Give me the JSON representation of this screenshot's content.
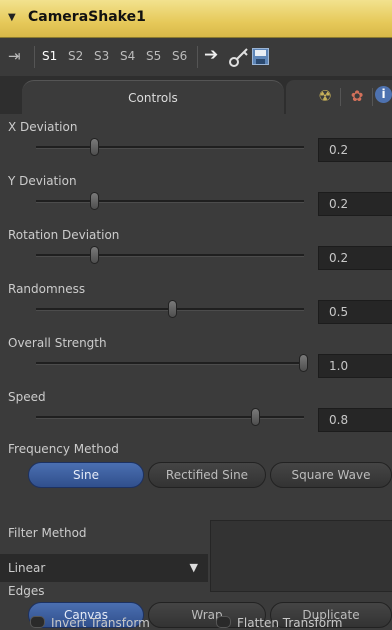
{
  "header": {
    "title": "CameraShake1",
    "collapse_icon": "triangle-down-icon"
  },
  "toolbar": {
    "pin_icon": "pin-icon",
    "slots": [
      "S1",
      "S2",
      "S3",
      "S4",
      "S5",
      "S6"
    ],
    "active_slot": "S1",
    "icons": [
      "arrow-icon",
      "key-icon",
      "save-icon"
    ]
  },
  "tabs": {
    "controls_label": "Controls",
    "icons": [
      "radioactive-icon",
      "gear-icon",
      "info-icon"
    ]
  },
  "controls": {
    "sliders": [
      {
        "label": "X Deviation",
        "value": "0.2",
        "position": 0.22
      },
      {
        "label": "Y Deviation",
        "value": "0.2",
        "position": 0.22
      },
      {
        "label": "Rotation Deviation",
        "value": "0.2",
        "position": 0.22
      },
      {
        "label": "Randomness",
        "value": "0.5",
        "position": 0.51
      },
      {
        "label": "Overall Strength",
        "value": "1.0",
        "position": 1.0
      },
      {
        "label": "Speed",
        "value": "0.8",
        "position": 0.82
      }
    ],
    "frequency_method": {
      "label": "Frequency Method",
      "options": [
        "Sine",
        "Rectified Sine",
        "Square Wave"
      ],
      "selected": "Sine"
    },
    "filter_method": {
      "label": "Filter Method",
      "value": "Linear"
    },
    "edges": {
      "label": "Edges",
      "options": [
        "Canvas",
        "Wrap",
        "Duplicate"
      ],
      "selected": "Canvas"
    },
    "checkboxes": [
      {
        "label": "Invert Transform",
        "checked": false
      },
      {
        "label": "Flatten Transform",
        "checked": false
      }
    ]
  },
  "colors": {
    "header_bg": "#e6c95a",
    "accent_blue": "#3f5fa0",
    "panel_bg": "#3b3b3b"
  }
}
